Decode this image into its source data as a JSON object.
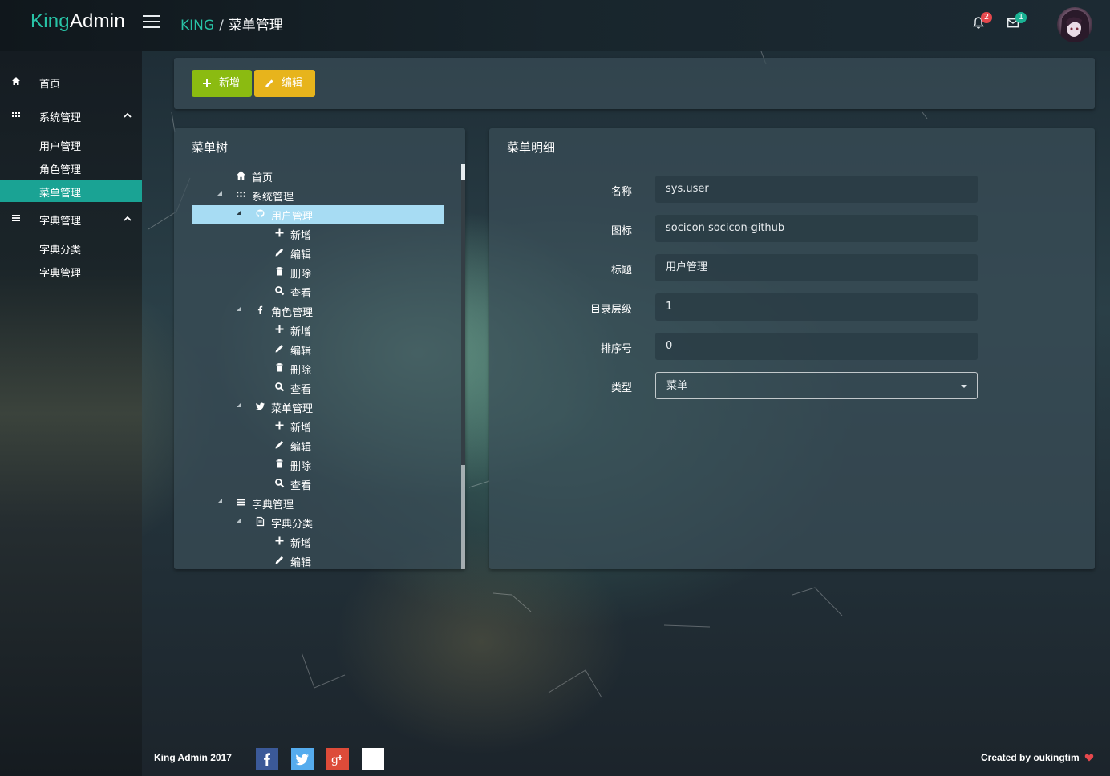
{
  "app": {
    "logo_part1": "King",
    "logo_part2": "Admin"
  },
  "breadcrumb": {
    "root": "KING",
    "separator": "/",
    "current": "菜单管理"
  },
  "header": {
    "notifications_count": "2",
    "messages_count": "1"
  },
  "sidebar": {
    "home": "首页",
    "system": "系统管理",
    "system_items": [
      "用户管理",
      "角色管理",
      "菜单管理"
    ],
    "dict": "字典管理",
    "dict_items": [
      "字典分类",
      "字典管理"
    ]
  },
  "toolbar": {
    "add_label": "新增",
    "edit_label": "编辑"
  },
  "tree": {
    "title": "菜单树",
    "nodes": [
      {
        "label": "首页",
        "icon": "home-icon",
        "level": 1
      },
      {
        "label": "系统管理",
        "icon": "grid-icon",
        "level": 1
      },
      {
        "label": "用户管理",
        "icon": "github-icon",
        "level": 2,
        "selected": true
      },
      {
        "label": "新增",
        "icon": "plus-icon",
        "level": 3
      },
      {
        "label": "编辑",
        "icon": "pencil-icon",
        "level": 3
      },
      {
        "label": "删除",
        "icon": "trash-icon",
        "level": 3
      },
      {
        "label": "查看",
        "icon": "search-icon",
        "level": 3
      },
      {
        "label": "角色管理",
        "icon": "facebook-icon",
        "level": 2
      },
      {
        "label": "新增",
        "icon": "plus-icon",
        "level": 3
      },
      {
        "label": "编辑",
        "icon": "pencil-icon",
        "level": 3
      },
      {
        "label": "删除",
        "icon": "trash-icon",
        "level": 3
      },
      {
        "label": "查看",
        "icon": "search-icon",
        "level": 3
      },
      {
        "label": "菜单管理",
        "icon": "twitter-icon",
        "level": 2
      },
      {
        "label": "新增",
        "icon": "plus-icon",
        "level": 3
      },
      {
        "label": "编辑",
        "icon": "pencil-icon",
        "level": 3
      },
      {
        "label": "删除",
        "icon": "trash-icon",
        "level": 3
      },
      {
        "label": "查看",
        "icon": "search-icon",
        "level": 3
      },
      {
        "label": "字典管理",
        "icon": "list-icon",
        "level": 1
      },
      {
        "label": "字典分类",
        "icon": "document-icon",
        "level": 2
      },
      {
        "label": "新增",
        "icon": "plus-icon",
        "level": 3
      },
      {
        "label": "编辑",
        "icon": "pencil-icon",
        "level": 3
      }
    ]
  },
  "detail": {
    "title": "菜单明细",
    "fields": {
      "name_label": "名称",
      "name_value": "sys.user",
      "icon_label": "图标",
      "icon_value": "socicon socicon-github",
      "title_label": "标题",
      "title_value": "用户管理",
      "level_label": "目录层级",
      "level_value": "1",
      "order_label": "排序号",
      "order_value": "0",
      "type_label": "类型",
      "type_value": "菜单"
    }
  },
  "footer": {
    "left": "King Admin 2017",
    "right": "Created by oukingtim",
    "social": [
      "facebook-icon",
      "twitter-icon",
      "google-plus-icon"
    ]
  },
  "colors": {
    "accent": "#28c2a6",
    "active_nav": "#1aa394",
    "add_button": "#8bbb11",
    "edit_button": "#e7b41c",
    "selected_node": "#a7dcf3",
    "badge_red": "#e5484d",
    "badge_green": "#1ab394"
  }
}
